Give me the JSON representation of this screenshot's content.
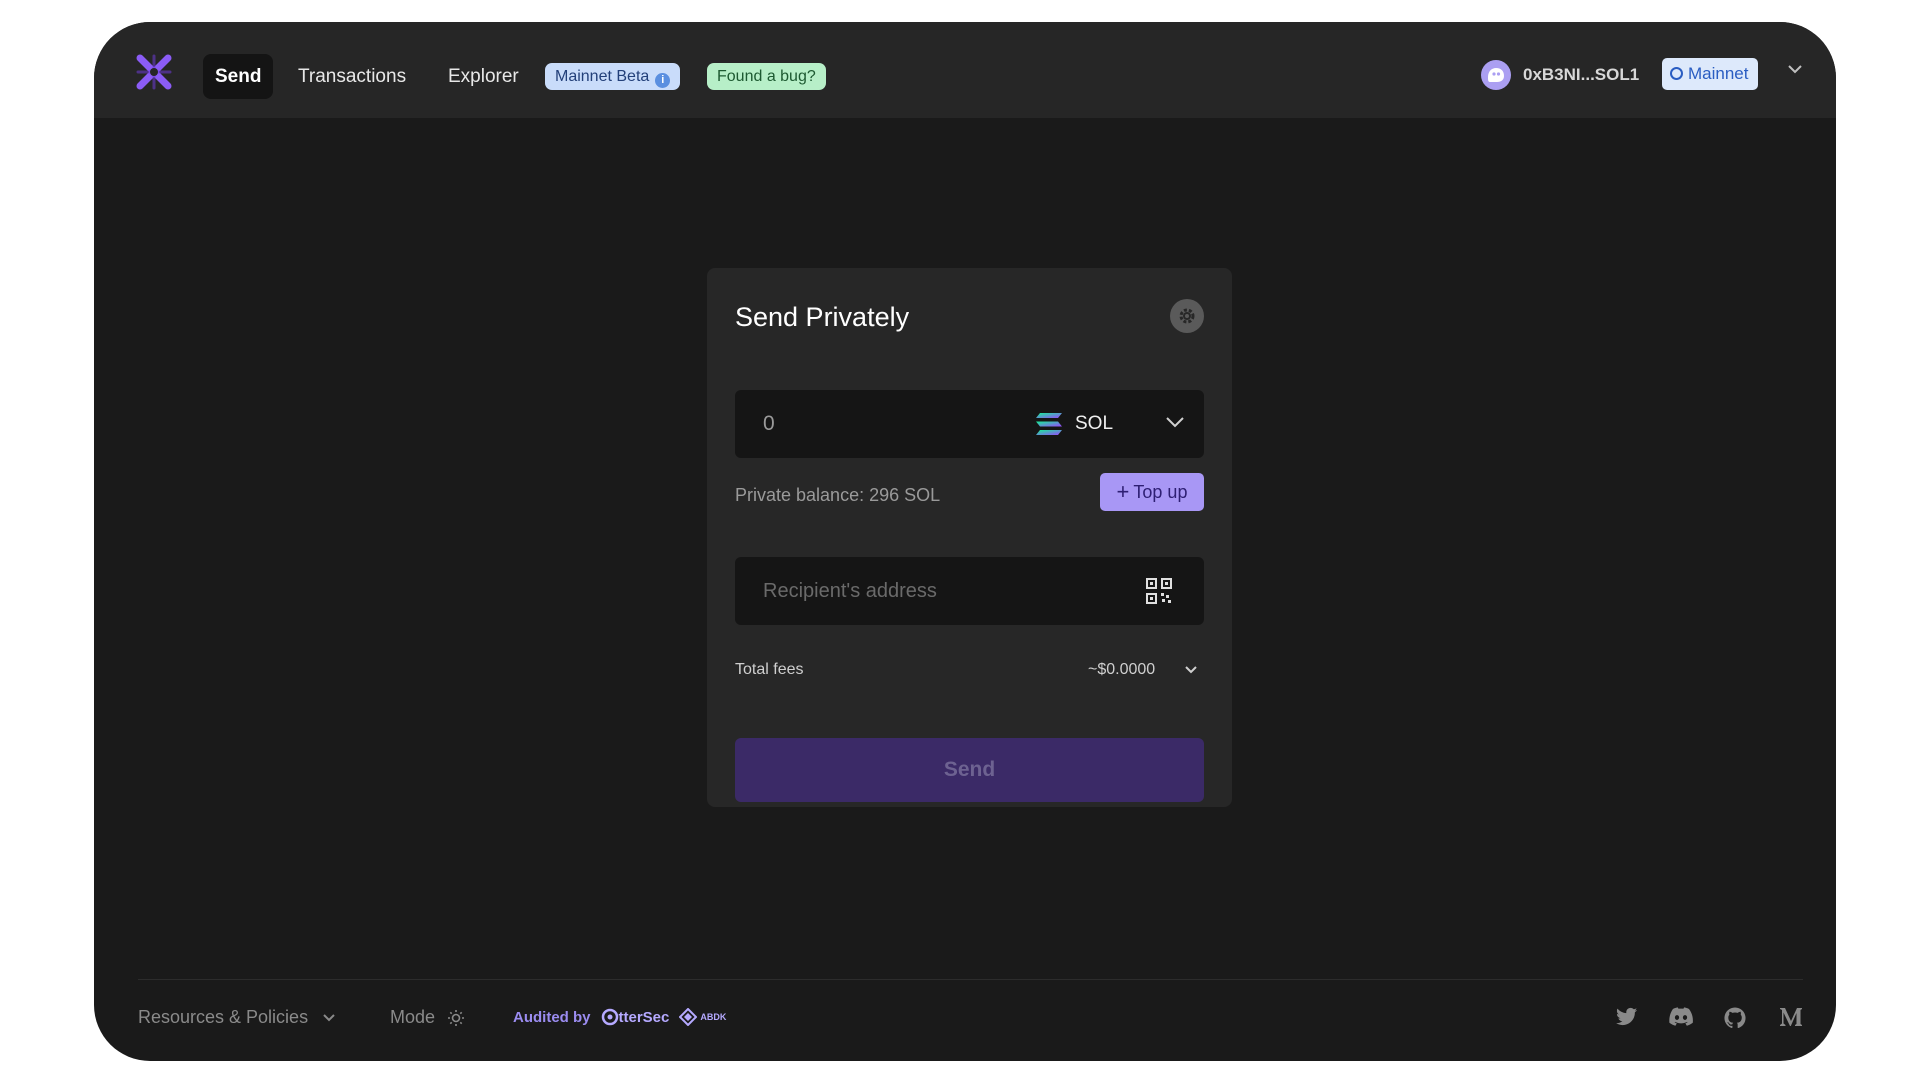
{
  "nav": {
    "items": [
      {
        "label": "Send",
        "active": true
      },
      {
        "label": "Transactions",
        "active": false
      },
      {
        "label": "Explorer",
        "active": false
      }
    ],
    "badges": {
      "mainnet_beta": "Mainnet Beta",
      "found_bug": "Found a bug?"
    }
  },
  "wallet": {
    "address": "0xB3NI...SOL1"
  },
  "network": {
    "label": "Mainnet"
  },
  "card": {
    "title": "Send Privately",
    "amount": {
      "value": "0",
      "token": "SOL"
    },
    "balance_text": "Private balance: 296 SOL",
    "topup_label": "Top up",
    "recipient_placeholder": "Recipient's address",
    "fees": {
      "label": "Total fees",
      "value": "~$0.0000"
    },
    "send_label": "Send"
  },
  "footer": {
    "resources_label": "Resources & Policies",
    "mode_label": "Mode",
    "audited_label": "Audited by",
    "auditor_1": "tterSec",
    "auditor_2": "ABDK"
  },
  "colors": {
    "accent": "#a897f5",
    "send_button": "#3b2a67",
    "background": "#1a1a1a",
    "card": "#272727"
  },
  "icons": [
    "logo-icon",
    "info-icon",
    "wallet-avatar-icon",
    "network-icon",
    "chevron-down-icon",
    "settings-icon",
    "solana-icon",
    "plus-icon",
    "qr-code-icon",
    "sun-icon",
    "otter-icon",
    "abdk-icon",
    "twitter-icon",
    "discord-icon",
    "github-icon",
    "medium-icon"
  ]
}
